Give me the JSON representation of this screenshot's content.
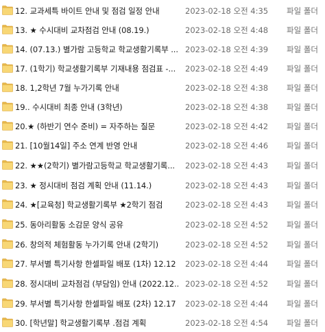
{
  "icon": "folder-icon",
  "colors": {
    "folder_body": "#f8d775",
    "folder_tab": "#e8b84a",
    "folder_edge": "#d9a43a",
    "secondary_text": "#6d6d6d",
    "primary_text": "#1a1a1a"
  },
  "files": [
    {
      "name": "12. 교과세특 바이트 안내 및 점검 일정 안내",
      "date": "2023-02-18 오전 4:35",
      "type": "파일 폴더"
    },
    {
      "name": "13. ★ 수시대비 교차점검 안내 (08.19.)",
      "date": "2023-02-18 오전 4:48",
      "type": "파일 폴더"
    },
    {
      "name": "14. (07.13.) 별가람 고등학교 학교생활기록부 ...",
      "date": "2023-02-18 오전 4:39",
      "type": "파일 폴더"
    },
    {
      "name": "17. (1학기) 학교생활기록부 기재내용 점검표 -...",
      "date": "2023-02-18 오전 4:49",
      "type": "파일 폴더"
    },
    {
      "name": "18. 1,2학년 7월 누가기록 안내",
      "date": "2023-02-18 오전 4:38",
      "type": "파일 폴더"
    },
    {
      "name": "19.. 수시대비 최종 안내 (3학년)",
      "date": "2023-02-18 오전 4:38",
      "type": "파일 폴더"
    },
    {
      "name": "20.★ (하반기 연수 준비) = 자주하는 질문",
      "date": "2023-02-18 오전 4:42",
      "type": "파일 폴더"
    },
    {
      "name": "21. [10월14일] 주소 연계 반영 안내",
      "date": "2023-02-18 오전 4:46",
      "type": "파일 폴더"
    },
    {
      "name": "22. ★★(2학기) 별가람고등학교 학교생활기록...",
      "date": "2023-02-18 오전 4:43",
      "type": "파일 폴더"
    },
    {
      "name": "23. ★ 정시대비 점검 계획 안내 (11.14.)",
      "date": "2023-02-18 오전 4:43",
      "type": "파일 폴더"
    },
    {
      "name": "24. ★[교육청] 학교생활기록부 ★2학기 점검",
      "date": "2023-02-18 오전 4:43",
      "type": "파일 폴더"
    },
    {
      "name": "25. 동아리활동 소감문 양식 공유",
      "date": "2023-02-18 오전 4:52",
      "type": "파일 폴더"
    },
    {
      "name": "26. 창의적 체험활동 누가기록 안내 (2학기)",
      "date": "2023-02-18 오전 4:52",
      "type": "파일 폴더"
    },
    {
      "name": "27. 부서별 특기사항 한셀파일 배포 (1차) 12.12",
      "date": "2023-02-18 오전 4:44",
      "type": "파일 폴더"
    },
    {
      "name": "28. 정시대비 교차점검 (부담임) 안내 (2022.12....",
      "date": "2023-02-18 오전 4:52",
      "type": "파일 폴더"
    },
    {
      "name": "29. 부서별 특기사항 한셀파일 배포 (2차) 12.17",
      "date": "2023-02-18 오전 4:44",
      "type": "파일 폴더"
    },
    {
      "name": "30. [학년말] 학교생활기록부 .점검 계획",
      "date": "2023-02-18 오전 4:54",
      "type": "파일 폴더"
    }
  ]
}
